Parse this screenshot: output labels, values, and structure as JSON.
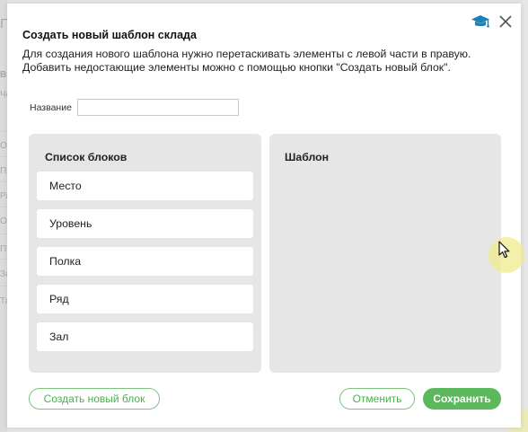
{
  "background": {
    "fragments": [
      "Па",
      "Вы",
      "Че",
      "О",
      "Пр",
      "Ра",
      "От",
      "Пр",
      "За",
      "Та"
    ]
  },
  "modal": {
    "title": "Создать новый шаблон склада",
    "description_line1": "Для создания нового шаблона нужно перетаскивать элементы с левой части в правую.",
    "description_line2": "Добавить недостающие элементы можно с помощью кнопки \"Создать новый блок\".",
    "help_icon": "graduation-cap-icon",
    "close_icon": "close-icon",
    "name_field": {
      "label": "Название",
      "value": "",
      "placeholder": ""
    },
    "blocks_panel": {
      "title": "Список блоков",
      "items": [
        "Место",
        "Уровень",
        "Полка",
        "Ряд",
        "Зал"
      ]
    },
    "template_panel": {
      "title": "Шаблон"
    },
    "buttons": {
      "create_block": "Создать новый блок",
      "cancel": "Отменить",
      "save": "Сохранить"
    }
  },
  "colors": {
    "accent_green": "#5cb85c",
    "outline_green": "#7cc47e",
    "help_icon_blue": "#1f7fb6",
    "panel_gray": "#e6e6e6"
  }
}
